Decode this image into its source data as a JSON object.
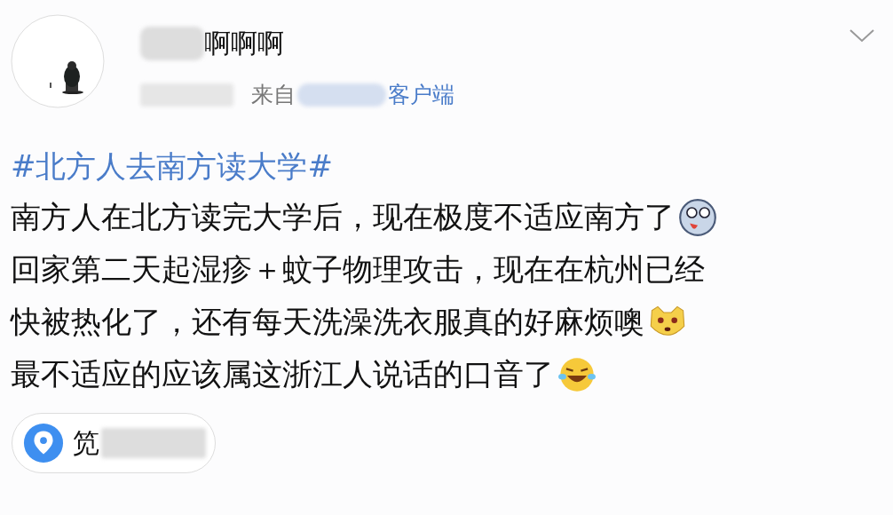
{
  "author": {
    "name": "啊啊啊",
    "source_prefix": "来自",
    "source_client": "客户端"
  },
  "hashtag": "#北方人去南方读大学#",
  "lines": [
    {
      "text": "南方人在北方读完大学后，现在极度不适应南方了",
      "kind": "husky"
    },
    {
      "text": "回家第二天起湿疹＋蚊子物理攻击，现在在杭州已经",
      "kind": "plain"
    },
    {
      "text": "快被热化了，还有每天洗澡洗衣服真的好麻烦噢",
      "kind": "doge"
    },
    {
      "text": "最不适应的应该属这浙江人说话的口音了",
      "kind": "laugh"
    }
  ],
  "location": {
    "text": "笕"
  }
}
